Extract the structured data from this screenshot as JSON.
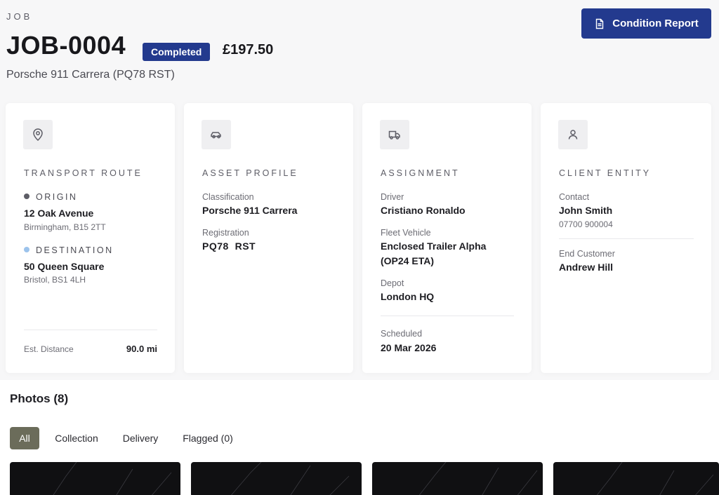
{
  "header": {
    "eyebrow": "JOB",
    "job_id": "JOB-0004",
    "status": "Completed",
    "price": "£197.50",
    "subtitle": "Porsche 911 Carrera (PQ78 RST)",
    "condition_report_label": "Condition Report"
  },
  "route": {
    "title": "TRANSPORT ROUTE",
    "origin_label": "ORIGIN",
    "origin_address": "12 Oak Avenue",
    "origin_city": "Birmingham, B15 2TT",
    "destination_label": "DESTINATION",
    "destination_address": "50 Queen Square",
    "destination_city": "Bristol, BS1 4LH",
    "distance_label": "Est. Distance",
    "distance_value": "90.0 mi"
  },
  "asset": {
    "title": "ASSET PROFILE",
    "classification_label": "Classification",
    "classification_value": "Porsche 911 Carrera",
    "registration_label": "Registration",
    "registration_value": "PQ78  RST"
  },
  "assignment": {
    "title": "ASSIGNMENT",
    "driver_label": "Driver",
    "driver_value": "Cristiano Ronaldo",
    "vehicle_label": "Fleet Vehicle",
    "vehicle_line1": "Enclosed Trailer Alpha",
    "vehicle_line2": "(OP24 ETA)",
    "depot_label": "Depot",
    "depot_value": "London HQ",
    "scheduled_label": "Scheduled",
    "scheduled_value": "20 Mar 2026"
  },
  "client": {
    "title": "CLIENT ENTITY",
    "contact_label": "Contact",
    "contact_name": "John Smith",
    "contact_phone": "07700 900004",
    "end_customer_label": "End Customer",
    "end_customer_value": "Andrew Hill"
  },
  "photos": {
    "title": "Photos (8)",
    "filters": [
      "All",
      "Collection",
      "Delivery",
      "Flagged (0)"
    ],
    "active_filter": "All"
  },
  "colors": {
    "accent": "#233a8e",
    "origin_dot": "#5d5d66",
    "destination_dot": "#9cc3ec",
    "active_filter": "#6b6c5a"
  },
  "icons": {
    "condition_report": "document-icon",
    "route": "map-pin-icon",
    "asset": "car-icon",
    "assignment": "truck-icon",
    "client": "user-icon"
  }
}
